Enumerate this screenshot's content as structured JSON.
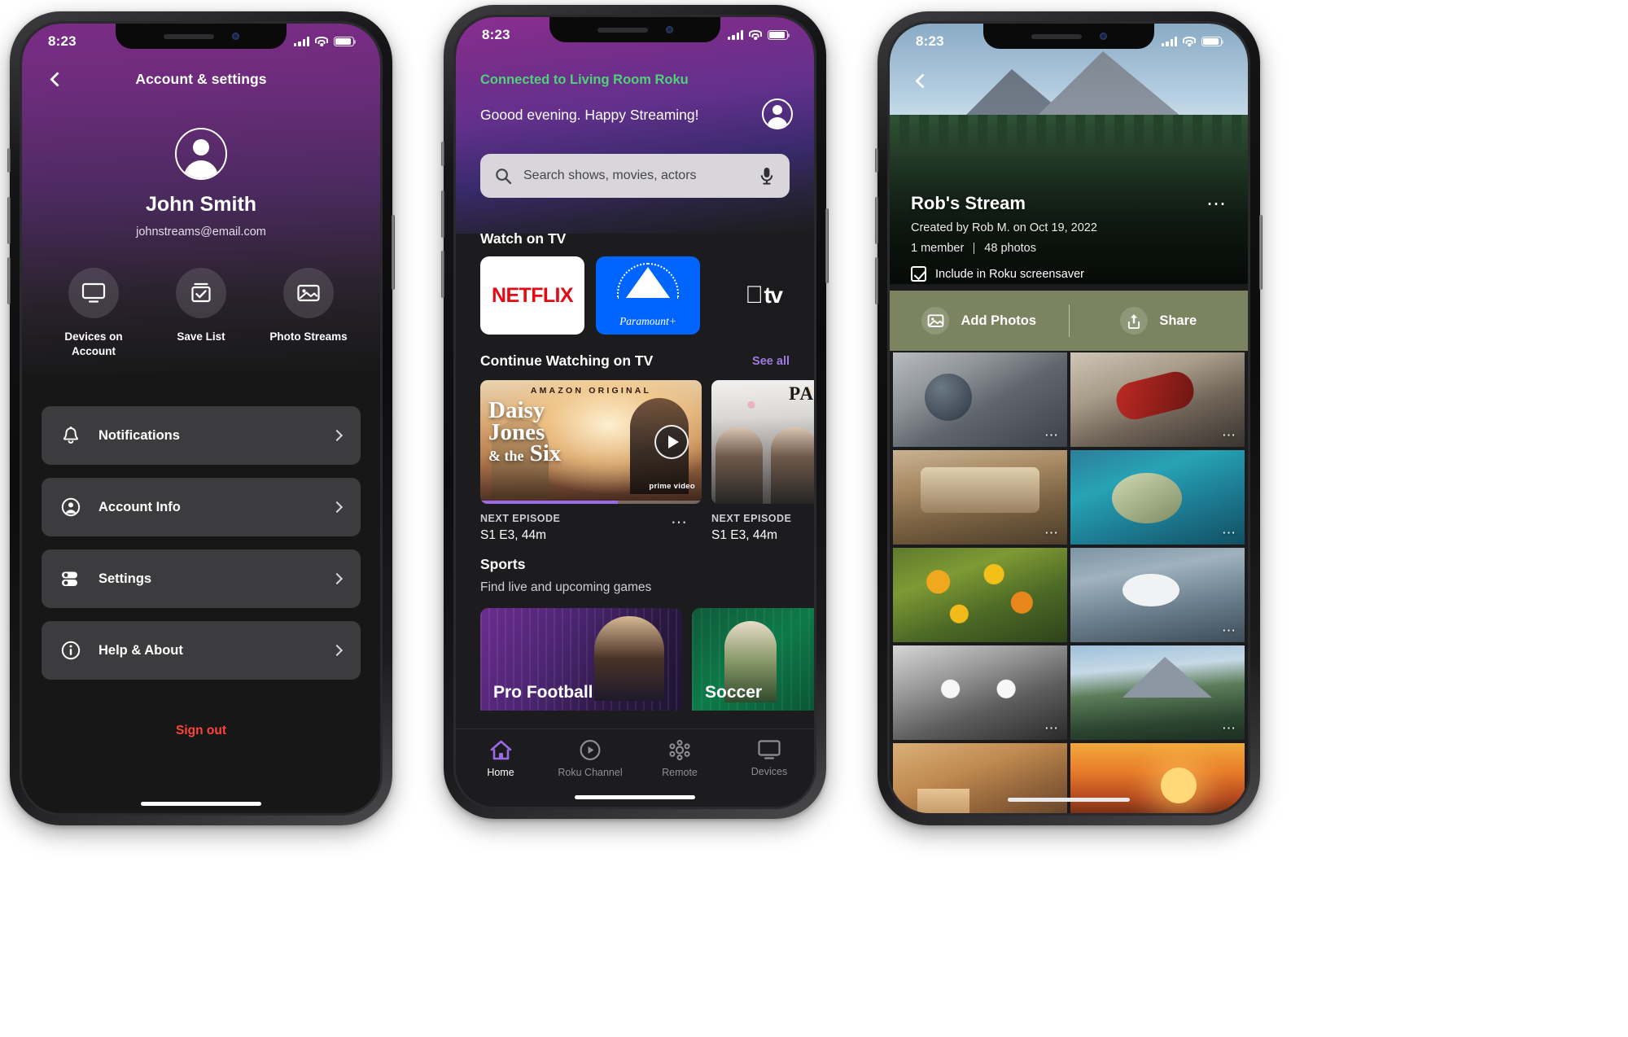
{
  "status_bar": {
    "time": "8:23"
  },
  "colors": {
    "purple_brand": "#662D91",
    "accent_purple": "#9B6AE8",
    "connected_green": "#4FD27A",
    "sign_out_red": "#FF453A",
    "netflix_red": "#E50914",
    "paramount_blue": "#0064FF",
    "action_bar_olive": "#7B8360"
  },
  "phone1": {
    "nav": {
      "back_icon": "chevron-left-icon",
      "title": "Account & settings"
    },
    "profile": {
      "avatar_icon": "person-avatar-icon",
      "name": "John Smith",
      "email": "johnstreams@email.com"
    },
    "quick_actions": [
      {
        "icon": "tv-monitor-icon",
        "label": "Devices on Account"
      },
      {
        "icon": "checklist-icon",
        "label": "Save List"
      },
      {
        "icon": "photo-stream-icon",
        "label": "Photo Streams"
      }
    ],
    "menu": [
      {
        "icon": "bell-icon",
        "label": "Notifications"
      },
      {
        "icon": "account-circle-icon",
        "label": "Account Info"
      },
      {
        "icon": "sliders-icon",
        "label": "Settings"
      },
      {
        "icon": "info-circle-icon",
        "label": "Help & About"
      }
    ],
    "sign_out_label": "Sign out"
  },
  "phone2": {
    "connected_status": "Connected to Living Room Roku",
    "greeting": "Goood evening. Happy Streaming!",
    "profile_icon": "person-avatar-icon",
    "search": {
      "placeholder": "Search shows, movies, actors",
      "search_icon": "search-icon",
      "mic_icon": "microphone-icon"
    },
    "watch_on_tv": {
      "title": "Watch on TV",
      "channels": [
        {
          "name": "NETFLIX"
        },
        {
          "name": "Paramount+"
        },
        {
          "name": "tv",
          "brand": "apple-tv"
        },
        {
          "name": ""
        }
      ]
    },
    "continue_watching": {
      "title": "Continue Watching on TV",
      "see_all": "See all",
      "items": [
        {
          "badge": "AMAZON ORIGINAL",
          "title": "Daisy Jones & the Six",
          "provider": "prime video",
          "next_episode_label": "NEXT EPISODE",
          "episode": "S1 E3, 44m",
          "progress_pct": 62,
          "overflow_icon": "more-horizontal-icon"
        },
        {
          "badge": "",
          "title": "PARTY",
          "provider": "",
          "next_episode_label": "NEXT EPISODE",
          "episode": "S1 E3, 44m",
          "progress_pct": 0,
          "overflow_icon": ""
        }
      ]
    },
    "sports": {
      "title": "Sports",
      "subtitle": "Find live and upcoming games",
      "cards": [
        {
          "name": "Pro Football"
        },
        {
          "name": "Soccer"
        }
      ]
    },
    "tabs": [
      {
        "icon": "home-icon",
        "label": "Home",
        "active": true
      },
      {
        "icon": "play-circle-icon",
        "label": "Roku Channel",
        "active": false
      },
      {
        "icon": "remote-icon",
        "label": "Remote",
        "active": false
      },
      {
        "icon": "devices-icon",
        "label": "Devices",
        "active": false
      }
    ]
  },
  "phone3": {
    "back_icon": "chevron-left-icon",
    "stream_title": "Rob's Stream",
    "created_by": "Created by Rob M. on Oct 19, 2022",
    "member_count": "1 member",
    "photo_count": "48 photos",
    "overflow_icon": "more-horizontal-icon",
    "screensaver_checkbox": {
      "label": "Include in Roku screensaver",
      "checked": true
    },
    "actions": [
      {
        "icon": "add-photos-icon",
        "label": "Add Photos"
      },
      {
        "icon": "share-icon",
        "label": "Share"
      }
    ],
    "photos": [
      {
        "alt": "pigeons",
        "class": "img-pigeons",
        "overflow_icon": "more-horizontal-icon"
      },
      {
        "alt": "motorcycle",
        "class": "img-moto",
        "overflow_icon": "more-horizontal-icon"
      },
      {
        "alt": "globe-theatre",
        "class": "img-globe",
        "overflow_icon": "more-horizontal-icon"
      },
      {
        "alt": "sea-turtle",
        "class": "img-turtle",
        "overflow_icon": "more-horizontal-icon"
      },
      {
        "alt": "orange-flowers",
        "class": "img-flowers",
        "overflow_icon": ""
      },
      {
        "alt": "seagull",
        "class": "img-gull",
        "overflow_icon": "more-horizontal-icon"
      },
      {
        "alt": "cat-face",
        "class": "img-cat",
        "overflow_icon": "more-horizontal-icon"
      },
      {
        "alt": "mountain-lake",
        "class": "img-lake2",
        "overflow_icon": "more-horizontal-icon"
      },
      {
        "alt": "village-houses",
        "class": "img-village",
        "overflow_icon": ""
      },
      {
        "alt": "sunset",
        "class": "img-sunset",
        "overflow_icon": ""
      }
    ]
  }
}
